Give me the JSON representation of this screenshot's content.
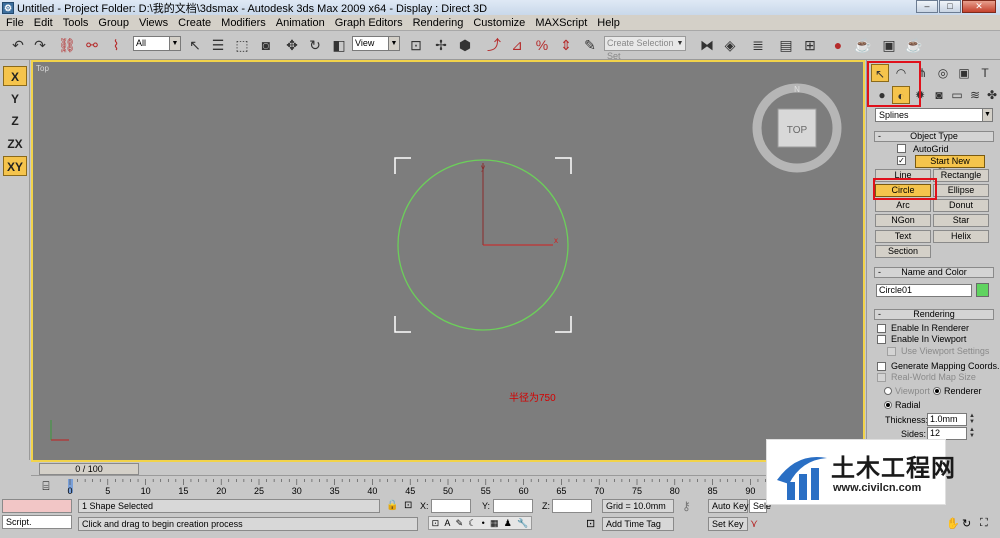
{
  "window": {
    "title": "Untitled    - Project Folder: D:\\我的文档\\3dsmax    - Autodesk 3ds Max  2009 x64     - Display : Direct 3D",
    "controls": [
      "–",
      "□",
      "✕"
    ]
  },
  "menu": [
    "File",
    "Edit",
    "Tools",
    "Group",
    "Views",
    "Create",
    "Modifiers",
    "Animation",
    "Graph Editors",
    "Rendering",
    "Customize",
    "MAXScript",
    "Help"
  ],
  "toolbar": {
    "selection_filter": "All",
    "reference_coord": "View",
    "selection_set_placeholder": "Create Selection Set"
  },
  "axis_buttons": [
    "X",
    "Y",
    "Z",
    "ZX",
    "XY"
  ],
  "viewport": {
    "label": "Top",
    "viewcube_label": "TOP",
    "compass_n": "N",
    "note": "半径为750",
    "axis_x": "x",
    "axis_y": "y"
  },
  "command_panel": {
    "category_dropdown": "Splines",
    "object_type": {
      "title": "Object Type",
      "autogrid": "AutoGrid",
      "start_new_shape": "Start New Shape",
      "buttons": [
        "Line",
        "Rectangle",
        "Circle",
        "Ellipse",
        "Arc",
        "Donut",
        "NGon",
        "Star",
        "Text",
        "Helix",
        "Section"
      ]
    },
    "name_and_color": {
      "title": "Name and Color",
      "name": "Circle01",
      "color": "#5fd35f"
    },
    "rendering": {
      "title": "Rendering",
      "enable_in_renderer": "Enable In Renderer",
      "enable_in_viewport": "Enable In Viewport",
      "use_viewport_settings": "Use Viewport Settings",
      "generate_mapping": "Generate Mapping Coords.",
      "real_world_map": "Real-World Map Size",
      "viewport": "Viewport",
      "renderer": "Renderer",
      "radial": "Radial",
      "thickness_label": "Thickness:",
      "thickness": "1.0mm",
      "sides_label": "Sides:",
      "sides": "12"
    }
  },
  "timeline": {
    "frame": "0 / 100",
    "ticks": [
      "0",
      "5",
      "10",
      "15",
      "20",
      "25",
      "30",
      "35",
      "40",
      "45",
      "50",
      "55",
      "60",
      "65",
      "70",
      "75",
      "80",
      "85",
      "90"
    ]
  },
  "status": {
    "script_label": "Script.",
    "selection": "1 Shape Selected",
    "prompt": "Click and drag to begin creation process",
    "x_label": "X:",
    "y_label": "Y:",
    "z_label": "Z:",
    "grid": "Grid = 10.0mm",
    "add_time_tag": "Add Time Tag",
    "auto_key": "Auto Key",
    "set_key": "Set Key",
    "selected_dd": "Sele"
  },
  "watermark": {
    "name": "土木工程网",
    "url": "www.civilcn.com"
  },
  "colors": {
    "accent": "#f5c44c",
    "viewport_bg": "#7d7d7d",
    "circle": "#6ccf5a",
    "highlight_box": "#e0101a"
  }
}
